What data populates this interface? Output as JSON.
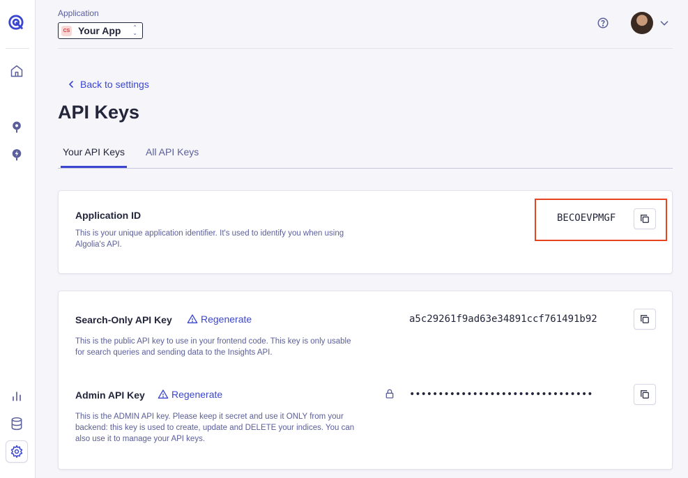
{
  "sidebar": {
    "items": [
      {
        "icon": "algolia-logo-icon"
      },
      {
        "icon": "home-icon"
      },
      {
        "icon": "search-icon"
      },
      {
        "icon": "bolt-icon"
      },
      {
        "icon": "chart-icon"
      },
      {
        "icon": "database-icon"
      },
      {
        "icon": "gear-icon",
        "active": true
      }
    ]
  },
  "header": {
    "app_label": "Application",
    "app_badge": "CS",
    "app_name": "Your App"
  },
  "nav": {
    "back_label": "Back to settings"
  },
  "page": {
    "title": "API Keys",
    "tabs": [
      {
        "label": "Your API Keys",
        "active": true
      },
      {
        "label": "All API Keys",
        "active": false
      }
    ]
  },
  "application_id": {
    "title": "Application ID",
    "description": "This is your unique application identifier. It's used to identify you when using Algolia's API.",
    "value": "BECOEVPMGF"
  },
  "search_key": {
    "title": "Search-Only API Key",
    "regenerate_label": "Regenerate",
    "description": "This is the public API key to use in your frontend code. This key is only usable for search queries and sending data to the Insights API.",
    "value": "a5c29261f9ad63e34891ccf761491b92"
  },
  "admin_key": {
    "title": "Admin API Key",
    "regenerate_label": "Regenerate",
    "description": "This is the ADMIN API key. Please keep it secret and use it ONLY from your backend: this key is used to create, update and DELETE your indices. You can also use it to manage your API keys.",
    "value": "••••••••••••••••••••••••••••••••"
  },
  "colors": {
    "accent": "#3a46d0",
    "highlight_border": "#e8431f",
    "text_primary": "#23263b",
    "text_secondary": "#5a5e9a"
  }
}
